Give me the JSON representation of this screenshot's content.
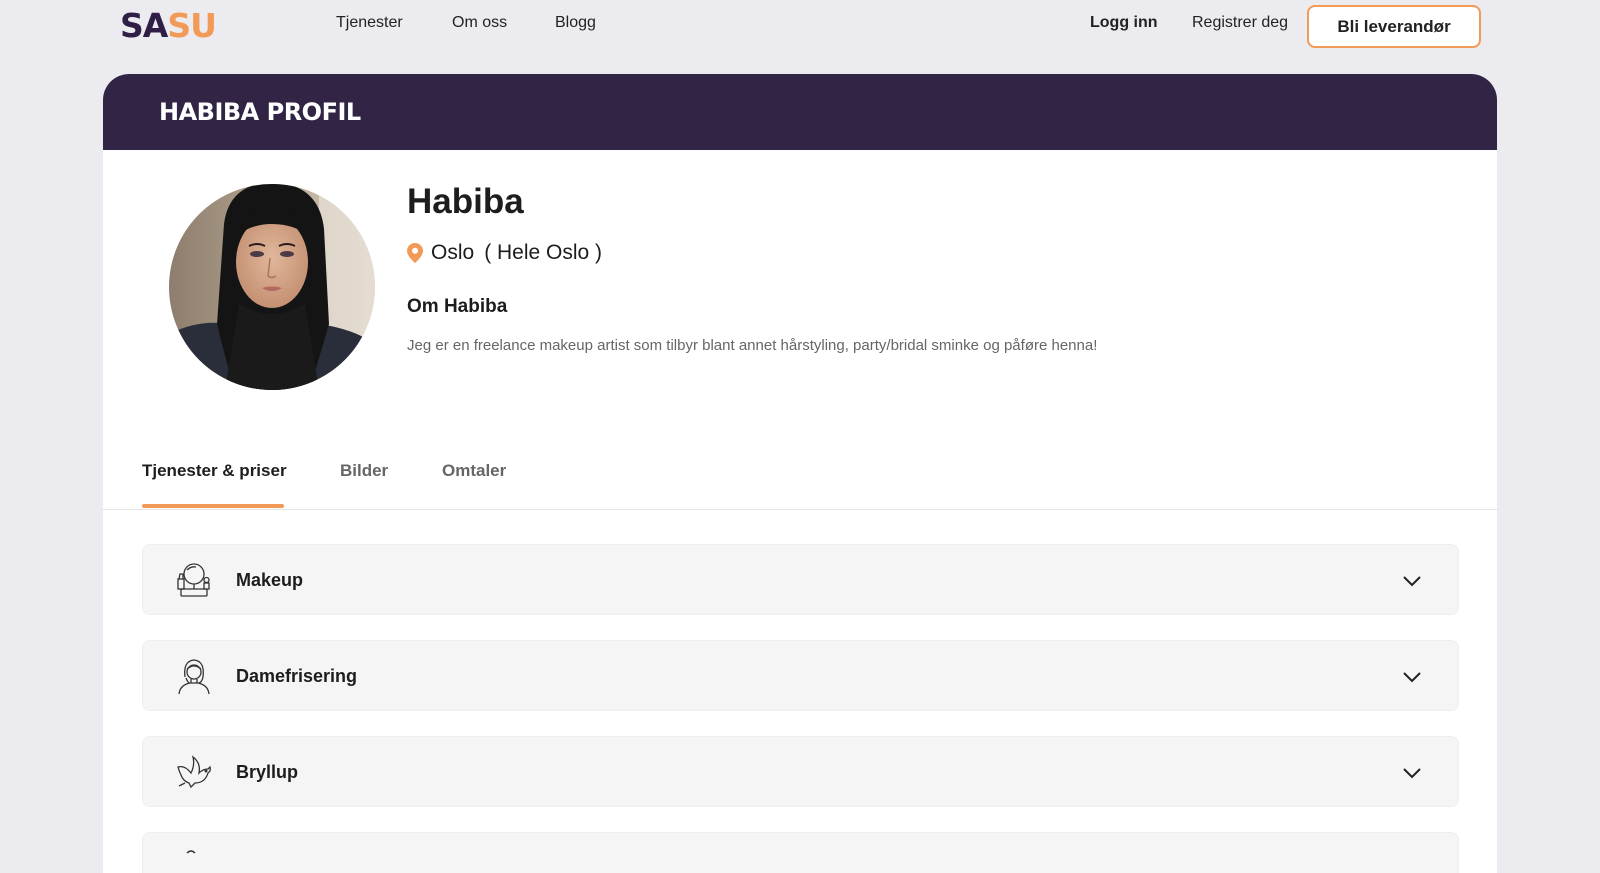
{
  "nav": {
    "logo_part1": "SA",
    "logo_part2": "SU",
    "links": [
      "Tjenester",
      "Om oss",
      "Blogg"
    ],
    "login": "Logg inn",
    "register": "Registrer deg",
    "cta": "Bli leverandør"
  },
  "profile": {
    "header": "HABIBA PROFIL",
    "name": "Habiba",
    "city": "Oslo",
    "area": "( Hele Oslo )",
    "about_title": "Om Habiba",
    "about_text": "Jeg er en freelance makeup artist som tilbyr blant annet hårstyling, party/bridal sminke og påføre henna!"
  },
  "tabs": [
    "Tjenester & priser",
    "Bilder",
    "Omtaler"
  ],
  "active_tab": "Tjenester & priser",
  "services": [
    {
      "label": "Makeup",
      "icon": "makeup-icon"
    },
    {
      "label": "Damefrisering",
      "icon": "woman-hair-icon"
    },
    {
      "label": "Bryllup",
      "icon": "dove-icon"
    },
    {
      "label": "",
      "icon": "partial-icon"
    }
  ],
  "colors": {
    "accent": "#f29a58",
    "header_bg": "#322444",
    "page_bg": "#ecebf0"
  }
}
